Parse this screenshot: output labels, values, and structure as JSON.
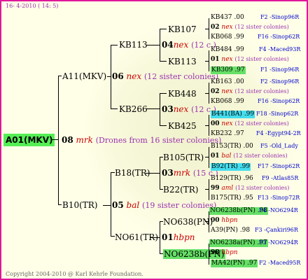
{
  "header": {
    "date": "16- 4-2010 ( 14: 5)"
  },
  "footer": {
    "copyright": "Copyright 2004-2010 @ Karl Kehrle Foundation."
  },
  "root": {
    "label": "A01(MKV)"
  },
  "gen1": [
    {
      "num": "08",
      "mark": "mrk",
      "note": "(Drones from 16 sister colonies)"
    }
  ],
  "gen2": [
    {
      "label": "A11(MKV)",
      "num": "06",
      "mark": "nex",
      "note": "(12 sister colonies)"
    },
    {
      "label": "B10(TR)",
      "num": "05",
      "mark": "bal",
      "note": "(19 sister colonies)"
    }
  ],
  "gen3": [
    {
      "label": "KB113",
      "num": "04",
      "mark": "nex",
      "note": "(12 c.)"
    },
    {
      "label": "KB266",
      "num": "03",
      "mark": "nex",
      "note": "(12 c.)"
    },
    {
      "label": "B18(TR)",
      "num": "03",
      "mark": "mrk",
      "note": "(15 c.)"
    },
    {
      "label": "NO61(TR)",
      "num": "01",
      "mark": "hbpn",
      "note": ""
    }
  ],
  "gen4": [
    {
      "label": "KB107"
    },
    {
      "label": "KB113"
    },
    {
      "label": "KB448"
    },
    {
      "label": "KB425"
    },
    {
      "label": "B105(TR)"
    },
    {
      "label": "B22(TR)"
    },
    {
      "label": "NO638(PN)"
    },
    {
      "label": "NO6238b(PN)"
    }
  ],
  "gen5": [
    {
      "id": "KB437",
      "val": ".00",
      "loc": "F2 -Sinop96R"
    },
    {
      "num": "02",
      "mark": "nex",
      "note": "(12 sister colonies)"
    },
    {
      "id": "KB068",
      "val": ".99",
      "loc": "F16 -Sinop62R"
    },
    {
      "id": "KB484",
      "val": ".99",
      "loc": "F4 -Maced93R"
    },
    {
      "num": "01",
      "mark": "nex",
      "note": "(12 sister colonies)"
    },
    {
      "id": "KB309",
      "val": ".97",
      "loc": "F1 -Sinop96R"
    },
    {
      "id": "KB163",
      "val": ".00",
      "loc": "F2 -Sinop96R"
    },
    {
      "num": "02",
      "mark": "nex",
      "note": "(12 sister colonies)"
    },
    {
      "id": "KB068",
      "val": ".99",
      "loc": "F16 -Sinop62R"
    },
    {
      "id": "B441(BA)",
      "val": ".99",
      "loc": "F18 -Sinop62R"
    },
    {
      "num": "00",
      "mark": "nex",
      "note": "(12 sister colonies)"
    },
    {
      "id": "KB232",
      "val": ".97",
      "loc": "F4 -Egypt94-2R"
    },
    {
      "id": "B153(TR)",
      "val": ".00",
      "loc": "F5 -Old_Lady"
    },
    {
      "num": "01",
      "mark": "bal",
      "note": "(12 sister colonies)"
    },
    {
      "id": "B92(TR)",
      "val": ".99",
      "loc": "F17 -Sinop62R"
    },
    {
      "id": "B129(TR)",
      "val": ".96",
      "loc": "F9 -Atlas85R"
    },
    {
      "num": "99",
      "mark": "aml",
      "note": "(12 sister colonies)"
    },
    {
      "id": "B175(TR)",
      "val": ".95",
      "loc": "F13 -Sinop72R"
    },
    {
      "id": "NO6238b(PN)",
      "val": ".98",
      "loc": "F4 -NO6294R"
    },
    {
      "num": "00",
      "mark": "hbpn",
      "note": ""
    },
    {
      "id": "A39(PN)",
      "val": ".98",
      "loc": "F3 -Çankiri96R"
    },
    {
      "id": "NO6238a(PN)",
      "val": ".97",
      "loc": "F3 -NO6294R"
    },
    {
      "num": "98",
      "mark": "hbpn",
      "note": ""
    },
    {
      "id": "MA42(PN)",
      "val": ".97",
      "loc": "F2 -Maced95R"
    }
  ]
}
